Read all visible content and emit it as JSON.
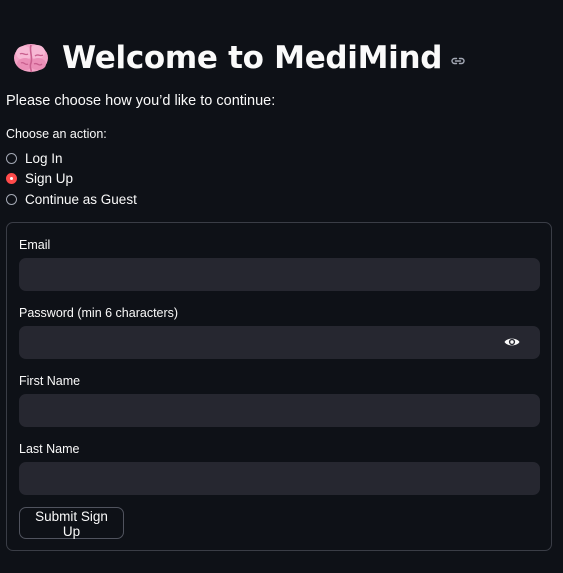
{
  "header": {
    "icon": "brain-emoji-icon",
    "title": "Welcome to MediMind",
    "link_icon": "link-icon"
  },
  "intro": "Please choose how you’d like to continue:",
  "action_radio": {
    "label": "Choose an action:",
    "options": [
      "Log In",
      "Sign Up",
      "Continue as Guest"
    ],
    "selected": "Sign Up"
  },
  "form": {
    "email_label": "Email",
    "email_value": "",
    "password_label": "Password (min 6 characters)",
    "password_value": "",
    "password_toggle_icon": "eye-icon",
    "first_name_label": "First Name",
    "first_name_value": "",
    "last_name_label": "Last Name",
    "last_name_value": "",
    "submit_label": "Submit Sign Up"
  },
  "colors": {
    "background": "#0e1117",
    "input_background": "#262730",
    "accent": "#ff4b4b",
    "text": "#fafafa"
  }
}
